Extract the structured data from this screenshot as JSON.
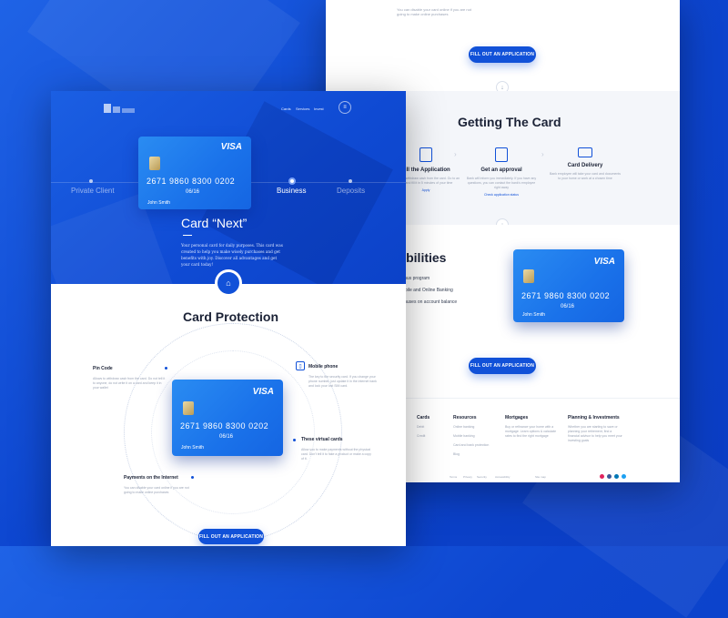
{
  "back_page": {
    "top_text": "You can disable your card online if you are not going to make online purchases",
    "fill_button": "FILL OUT AN APPLICATION",
    "getting": {
      "title": "Getting The Card",
      "steps": [
        {
          "title": "Fill the Application",
          "desc": "Allows to withdraw cash from the card. Go to an app and fill it in 5 minutes of your time",
          "link": "Apply"
        },
        {
          "title": "Get an approval",
          "desc": "Bank will inform you immediately. If you have any questions, you can contact the bank's employee right away",
          "link": "Check application status"
        },
        {
          "title": "Card Delivery",
          "desc": "Bank employee will take your card and documents to your home or work at a chosen time",
          "link": ""
        }
      ]
    },
    "abilities": {
      "title": "Abilities",
      "items": [
        "Bonus program",
        "Mobile and Online Banking",
        "Bonuses on account balance"
      ]
    },
    "fill_button_2": "FILL OUT AN APPLICATION",
    "footer": {
      "columns": [
        {
          "heading": "Cards",
          "links": [
            "Debit",
            "Credit"
          ]
        },
        {
          "heading": "Resources",
          "links": [
            "Online banking",
            "Mobile banking",
            "Card and bank protection",
            "Blog"
          ]
        },
        {
          "heading": "Mortgages",
          "links": [
            "Buy or refinance your home with a mortgage. Learn options & calculate rates to find the right mortgage"
          ]
        },
        {
          "heading": "Planning & Investments",
          "links": [
            "Whether you are starting to save or planning your retirement, find a financial advisor to help you meet your investing goals"
          ]
        }
      ],
      "bottom_links": [
        "Terms",
        "Privacy",
        "Security",
        "Accessibility",
        "Site map"
      ]
    }
  },
  "front_page": {
    "nav": [
      "Cards",
      "Services",
      "Invest"
    ],
    "tabs": [
      "Private Client",
      "Business",
      "Deposits"
    ],
    "active_tab": "Business",
    "card": {
      "brand": "VISA",
      "number": "2671  9860  8300  0202",
      "expiry": "06/16",
      "holder": "John Smith"
    },
    "card_title": "Card “Next”",
    "card_desc": "Your personal card for daily purposes. This card was created to help you make wisely purchases and get benefits with joy. Discover all advantages and get your card today!",
    "protection": {
      "title": "Card Protection",
      "features": [
        {
          "title": "Pin Code",
          "desc": "Allows to withdraw cash from the card. Do not tell it to anyone, do not write it on a card and keep it in your wallet"
        },
        {
          "title": "Mobile phone",
          "desc": "The key to the security card. If you change your phone number, just update it in the internet bank and lock your lost SIM card."
        },
        {
          "title": "These virtual cards",
          "desc": "Allow you to make payments without the physical card. Don't tell it to fake a product or make a copy of it."
        },
        {
          "title": "Payments on the Internet",
          "desc": "You can disable your card online if you are not going to make online purchases"
        }
      ]
    },
    "fill_button": "FILL OUT AN APPLICATION"
  }
}
